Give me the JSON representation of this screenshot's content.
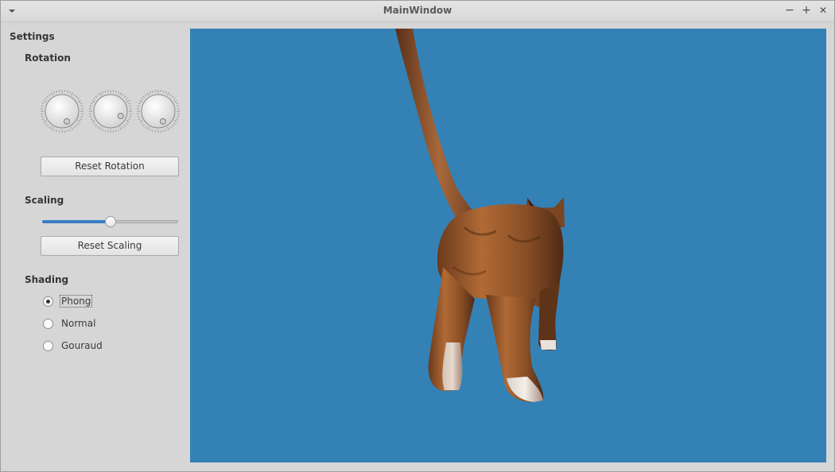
{
  "window": {
    "title": "MainWindow",
    "controls": {
      "minimize": "−",
      "maximize": "+",
      "close": "✕"
    }
  },
  "settings": {
    "title": "Settings",
    "rotation": {
      "title": "Rotation",
      "dials": [
        {
          "name": "x",
          "value_angle_deg": 205
        },
        {
          "name": "y",
          "value_angle_deg": 245
        },
        {
          "name": "z",
          "value_angle_deg": 205
        }
      ],
      "reset_label": "Reset Rotation"
    },
    "scaling": {
      "title": "Scaling",
      "value_fraction": 0.5,
      "reset_label": "Reset Scaling"
    },
    "shading": {
      "title": "Shading",
      "options": [
        {
          "label": "Phong",
          "selected": true
        },
        {
          "label": "Normal",
          "selected": false
        },
        {
          "label": "Gouraud",
          "selected": false
        }
      ]
    }
  },
  "viewport": {
    "background": "#3481b6",
    "model": "cat"
  },
  "colors": {
    "accent": "#3a7fc4",
    "viewport_bg": "#3481b6"
  }
}
